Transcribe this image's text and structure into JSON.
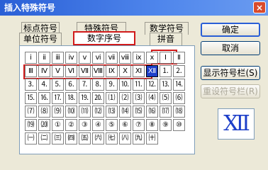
{
  "window": {
    "title": "插入特殊符号",
    "close_glyph": "×"
  },
  "tabs": {
    "row1": [
      "标点符号",
      "特殊符号",
      "数学符号"
    ],
    "row2": [
      "单位符号",
      "数字序号",
      "拼音"
    ],
    "active": "数字序号"
  },
  "grid": {
    "rows": [
      [
        "ⅰ",
        "ⅱ",
        "ⅲ",
        "ⅳ",
        "ⅴ",
        "ⅵ",
        "ⅶ",
        "ⅷ",
        "ⅸ",
        "ⅹ",
        "Ⅰ",
        "Ⅱ"
      ],
      [
        "Ⅲ",
        "Ⅳ",
        "Ⅴ",
        "Ⅵ",
        "Ⅶ",
        "Ⅷ",
        "Ⅸ",
        "Ⅹ",
        "Ⅺ",
        "Ⅻ",
        "⒈",
        "⒉"
      ],
      [
        "⒊",
        "⒋",
        "⒌",
        "⒍",
        "⒎",
        "⒏",
        "⒐",
        "⒑",
        "⒒",
        "⒓",
        "⒔",
        "⒕"
      ],
      [
        "⒖",
        "⒗",
        "⒘",
        "⒙",
        "⒚",
        "⒛",
        "⑴",
        "⑵",
        "⑶",
        "⑷",
        "⑸",
        "⑹"
      ],
      [
        "⑺",
        "⑻",
        "⑼",
        "⑽",
        "⑾",
        "⑿",
        "⒀",
        "⒁",
        "⒂",
        "⒃",
        "⒄",
        "⒅"
      ],
      [
        "⒆",
        "⒇",
        "①",
        "②",
        "③",
        "④",
        "⑤",
        "⑥",
        "⑦",
        "⑧",
        "⑨",
        "⑩"
      ],
      [
        "㈠",
        "㈡",
        "㈢",
        "㈣",
        "㈤",
        "㈥",
        "㈦",
        "㈧",
        "㈨",
        "㈩",
        "",
        ""
      ]
    ],
    "selected": "Ⅻ"
  },
  "buttons": {
    "ok": "确定",
    "cancel": "取消",
    "show_bar": "显示符号栏(S)",
    "reset_bar": "重设符号栏(R)"
  },
  "preview": {
    "symbol": "Ⅻ"
  },
  "colors": {
    "highlight_red": "#d11a1a",
    "selected_blue": "#1d3fc9",
    "title_blue": "#2a5fd6"
  }
}
